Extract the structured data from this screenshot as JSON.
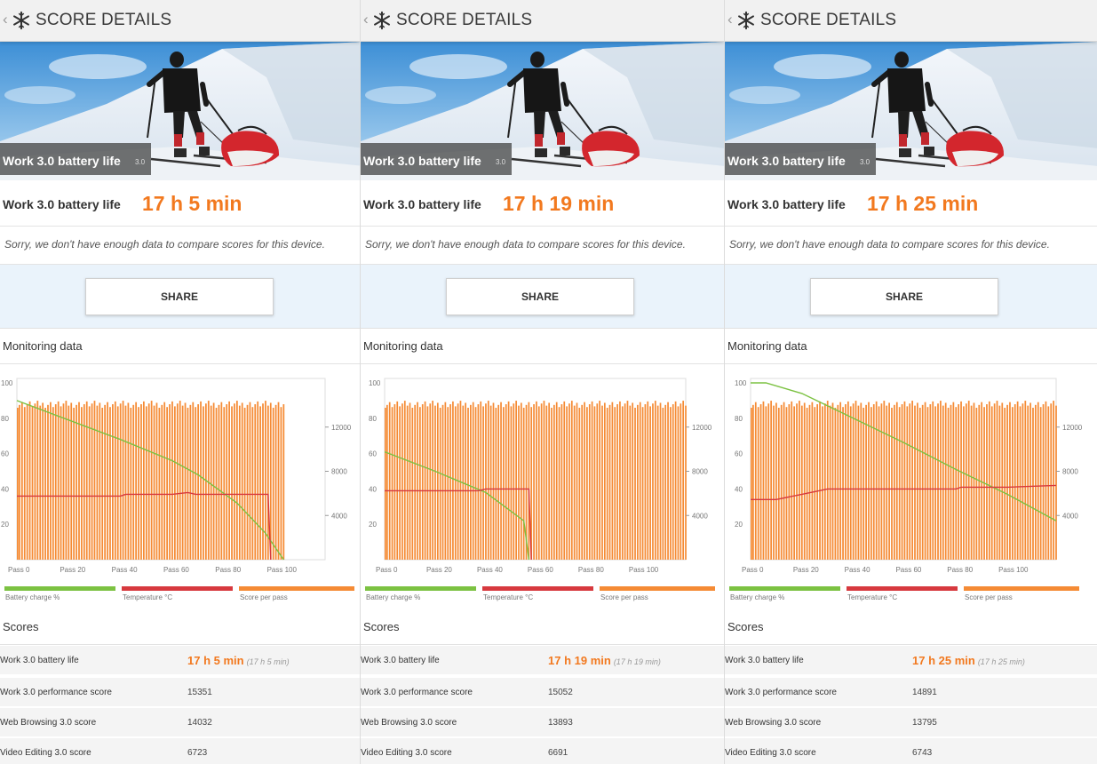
{
  "header": {
    "back": "‹",
    "title": "SCORE DETAILS"
  },
  "panels": [
    {
      "hero": {
        "title": "Work 3.0 battery life",
        "version": "3.0"
      },
      "result": {
        "label": "Work 3.0 battery life",
        "value": "17 h 5 min"
      },
      "notice": "Sorry, we don't have enough data to compare scores for this device.",
      "share_label": "SHARE",
      "monitoring_title": "Monitoring data",
      "chart_data": {
        "type": "bar",
        "x_ticks": [
          "Pass 0",
          "Pass 20",
          "Pass 40",
          "Pass 60",
          "Pass 80",
          "Pass 100"
        ],
        "x_range": [
          0,
          119
        ],
        "left_ticks": [
          "100",
          "80",
          "60",
          "40",
          "20"
        ],
        "left_range": [
          0,
          100
        ],
        "right_ticks": [
          "12000",
          "8000",
          "4000"
        ],
        "right_range": [
          0,
          16000
        ],
        "passes": 104,
        "series": [
          {
            "name": "Battery charge %",
            "color": "#7cc242",
            "type": "line",
            "points": [
              [
                0,
                90
              ],
              [
                20,
                79
              ],
              [
                40,
                68
              ],
              [
                60,
                56
              ],
              [
                70,
                48
              ],
              [
                85,
                32
              ],
              [
                96,
                15
              ],
              [
                103,
                0
              ]
            ]
          },
          {
            "name": "Temperature °C",
            "color": "#d7393e",
            "type": "line",
            "points": [
              [
                0,
                36
              ],
              [
                40,
                36
              ],
              [
                42,
                37
              ],
              [
                60,
                37
              ],
              [
                66,
                38
              ],
              [
                69,
                37
              ],
              [
                97,
                37
              ],
              [
                98,
                0
              ]
            ]
          },
          {
            "name": "Score per pass",
            "color": "#f58b35",
            "type": "bar",
            "value": 14100
          }
        ],
        "legend": [
          "Battery charge %",
          "Temperature °C",
          "Score per pass"
        ]
      },
      "scores_title": "Scores",
      "scores": [
        {
          "name": "Work 3.0 battery life",
          "value": "17 h 5 min",
          "sub": "(17 h 5 min)"
        },
        {
          "name": "Work 3.0 performance score",
          "value": "15351"
        },
        {
          "name": "Web Browsing 3.0 score",
          "value": "14032"
        },
        {
          "name": "Video Editing 3.0 score",
          "value": "6723"
        }
      ]
    },
    {
      "hero": {
        "title": "Work 3.0 battery life",
        "version": "3.0"
      },
      "result": {
        "label": "Work 3.0 battery life",
        "value": "17 h 19 min"
      },
      "notice": "Sorry, we don't have enough data to compare scores for this device.",
      "share_label": "SHARE",
      "monitoring_title": "Monitoring data",
      "chart_data": {
        "type": "bar",
        "x_ticks": [
          "Pass 0",
          "Pass 20",
          "Pass 40",
          "Pass 60",
          "Pass 80",
          "Pass 100"
        ],
        "x_range": [
          0,
          119
        ],
        "left_ticks": [
          "100",
          "80",
          "60",
          "40",
          "20"
        ],
        "left_range": [
          0,
          100
        ],
        "right_ticks": [
          "12000",
          "8000",
          "4000"
        ],
        "right_range": [
          0,
          16000
        ],
        "passes": 120,
        "series": [
          {
            "name": "Battery charge %",
            "color": "#7cc242",
            "type": "line",
            "points": [
              [
                0,
                61
              ],
              [
                20,
                50
              ],
              [
                40,
                38
              ],
              [
                55,
                22
              ],
              [
                57,
                0
              ]
            ]
          },
          {
            "name": "Temperature °C",
            "color": "#d7393e",
            "type": "line",
            "points": [
              [
                0,
                39
              ],
              [
                37,
                39
              ],
              [
                40,
                40
              ],
              [
                57,
                40
              ],
              [
                58,
                0
              ]
            ]
          },
          {
            "name": "Score per pass",
            "color": "#f58b35",
            "type": "bar",
            "value": 14100
          }
        ],
        "legend": [
          "Battery charge %",
          "Temperature °C",
          "Score per pass"
        ]
      },
      "scores_title": "Scores",
      "scores": [
        {
          "name": "Work 3.0 battery life",
          "value": "17 h 19 min",
          "sub": "(17 h 19 min)"
        },
        {
          "name": "Work 3.0 performance score",
          "value": "15052"
        },
        {
          "name": "Web Browsing 3.0 score",
          "value": "13893"
        },
        {
          "name": "Video Editing 3.0 score",
          "value": "6691"
        }
      ]
    },
    {
      "hero": {
        "title": "Work 3.0 battery life",
        "version": "3.0"
      },
      "result": {
        "label": "Work 3.0 battery life",
        "value": "17 h 25 min"
      },
      "notice": "Sorry, we don't have enough data to compare scores for this device.",
      "share_label": "SHARE",
      "monitoring_title": "Monitoring data",
      "chart_data": {
        "type": "bar",
        "x_ticks": [
          "Pass 0",
          "Pass 20",
          "Pass 40",
          "Pass 60",
          "Pass 80",
          "Pass 100"
        ],
        "x_range": [
          0,
          119
        ],
        "left_ticks": [
          "100",
          "80",
          "60",
          "40",
          "20"
        ],
        "left_range": [
          0,
          100
        ],
        "right_ticks": [
          "12000",
          "8000",
          "4000"
        ],
        "right_range": [
          0,
          16000
        ],
        "passes": 120,
        "series": [
          {
            "name": "Battery charge %",
            "color": "#7cc242",
            "type": "line",
            "points": [
              [
                0,
                100
              ],
              [
                6,
                100
              ],
              [
                20,
                94
              ],
              [
                40,
                80
              ],
              [
                60,
                66
              ],
              [
                80,
                51
              ],
              [
                100,
                37
              ],
              [
                119,
                22
              ]
            ]
          },
          {
            "name": "Temperature °C",
            "color": "#d7393e",
            "type": "line",
            "points": [
              [
                0,
                34
              ],
              [
                10,
                34
              ],
              [
                20,
                37
              ],
              [
                30,
                40
              ],
              [
                60,
                40
              ],
              [
                80,
                40
              ],
              [
                82,
                41
              ],
              [
                100,
                41
              ],
              [
                119,
                42
              ]
            ]
          },
          {
            "name": "Score per pass",
            "color": "#f58b35",
            "type": "bar",
            "value": 14100
          }
        ],
        "legend": [
          "Battery charge %",
          "Temperature °C",
          "Score per pass"
        ]
      },
      "scores_title": "Scores",
      "scores": [
        {
          "name": "Work 3.0 battery life",
          "value": "17 h 25 min",
          "sub": "(17 h 25 min)"
        },
        {
          "name": "Work 3.0 performance score",
          "value": "14891"
        },
        {
          "name": "Web Browsing 3.0 score",
          "value": "13795"
        },
        {
          "name": "Video Editing 3.0 score",
          "value": "6743"
        }
      ]
    }
  ]
}
